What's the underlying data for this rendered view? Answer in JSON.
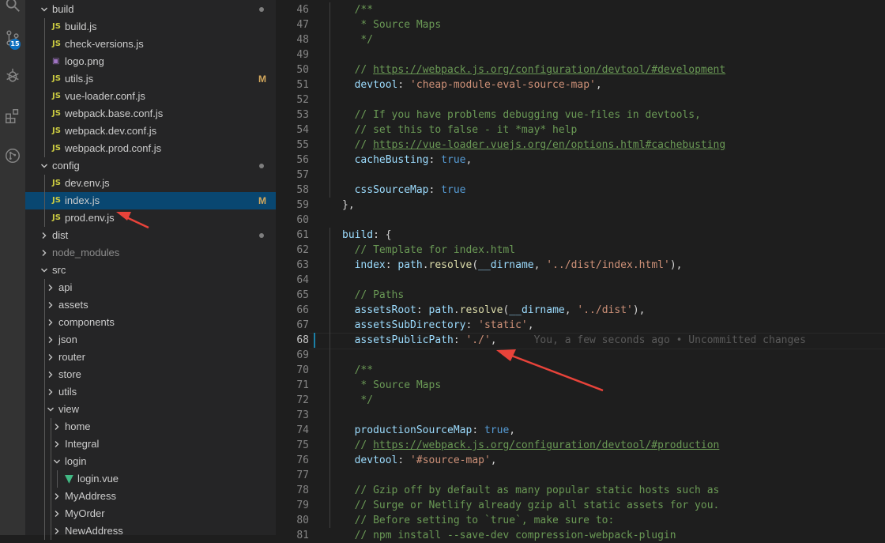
{
  "activity": {
    "scm_badge": "15"
  },
  "explorer": {
    "rows": [
      {
        "label": "build",
        "kind": "folder",
        "open": true,
        "depth": 1,
        "dot": true
      },
      {
        "label": "build.js",
        "kind": "js",
        "depth": 2
      },
      {
        "label": "check-versions.js",
        "kind": "js",
        "depth": 2
      },
      {
        "label": "logo.png",
        "kind": "img",
        "depth": 2
      },
      {
        "label": "utils.js",
        "kind": "js",
        "depth": 2,
        "status": "M"
      },
      {
        "label": "vue-loader.conf.js",
        "kind": "js",
        "depth": 2
      },
      {
        "label": "webpack.base.conf.js",
        "kind": "js",
        "depth": 2
      },
      {
        "label": "webpack.dev.conf.js",
        "kind": "js",
        "depth": 2
      },
      {
        "label": "webpack.prod.conf.js",
        "kind": "js",
        "depth": 2
      },
      {
        "label": "config",
        "kind": "folder",
        "open": true,
        "depth": 1,
        "dot": true
      },
      {
        "label": "dev.env.js",
        "kind": "js",
        "depth": 2
      },
      {
        "label": "index.js",
        "kind": "js",
        "depth": 2,
        "status": "M",
        "selected": true
      },
      {
        "label": "prod.env.js",
        "kind": "js",
        "depth": 2
      },
      {
        "label": "dist",
        "kind": "folder",
        "open": false,
        "depth": 1,
        "dot": true
      },
      {
        "label": "node_modules",
        "kind": "folder",
        "open": false,
        "depth": 1,
        "dim": true
      },
      {
        "label": "src",
        "kind": "folder",
        "open": true,
        "depth": 1
      },
      {
        "label": "api",
        "kind": "folder",
        "open": false,
        "depth": 2
      },
      {
        "label": "assets",
        "kind": "folder",
        "open": false,
        "depth": 2
      },
      {
        "label": "components",
        "kind": "folder",
        "open": false,
        "depth": 2
      },
      {
        "label": "json",
        "kind": "folder",
        "open": false,
        "depth": 2
      },
      {
        "label": "router",
        "kind": "folder",
        "open": false,
        "depth": 2
      },
      {
        "label": "store",
        "kind": "folder",
        "open": false,
        "depth": 2
      },
      {
        "label": "utils",
        "kind": "folder",
        "open": false,
        "depth": 2
      },
      {
        "label": "view",
        "kind": "folder",
        "open": true,
        "depth": 2
      },
      {
        "label": "home",
        "kind": "folder",
        "open": false,
        "depth": 3
      },
      {
        "label": "Integral",
        "kind": "folder",
        "open": false,
        "depth": 3
      },
      {
        "label": "login",
        "kind": "folder",
        "open": true,
        "depth": 3
      },
      {
        "label": "login.vue",
        "kind": "vue",
        "depth": 4
      },
      {
        "label": "MyAddress",
        "kind": "folder",
        "open": false,
        "depth": 3
      },
      {
        "label": "MyOrder",
        "kind": "folder",
        "open": false,
        "depth": 3
      },
      {
        "label": "NewAddress",
        "kind": "folder",
        "open": false,
        "depth": 3
      }
    ],
    "icon_text": {
      "js": "JS",
      "img": "▣",
      "vue": "▼"
    }
  },
  "editor": {
    "active_line": "68",
    "blame": "You, a few seconds ago • Uncommitted changes",
    "lines": [
      {
        "n": "46",
        "indent": 2,
        "seg": [
          [
            "cm",
            "/**"
          ]
        ]
      },
      {
        "n": "47",
        "indent": 2,
        "seg": [
          [
            "cm",
            " * Source Maps"
          ]
        ]
      },
      {
        "n": "48",
        "indent": 2,
        "seg": [
          [
            "cm",
            " */"
          ]
        ]
      },
      {
        "n": "49",
        "indent": 0,
        "seg": []
      },
      {
        "n": "50",
        "indent": 2,
        "seg": [
          [
            "cm",
            "// "
          ],
          [
            "cm-link",
            "https://webpack.js.org/configuration/devtool/#development"
          ]
        ]
      },
      {
        "n": "51",
        "indent": 2,
        "seg": [
          [
            "kw",
            "devtool"
          ],
          [
            "p",
            ": "
          ],
          [
            "str",
            "'cheap-module-eval-source-map'"
          ],
          [
            "p",
            ","
          ]
        ]
      },
      {
        "n": "52",
        "indent": 0,
        "seg": []
      },
      {
        "n": "53",
        "indent": 2,
        "seg": [
          [
            "cm",
            "// If you have problems debugging vue-files in devtools,"
          ]
        ]
      },
      {
        "n": "54",
        "indent": 2,
        "seg": [
          [
            "cm",
            "// set this to false - it *may* help"
          ]
        ]
      },
      {
        "n": "55",
        "indent": 2,
        "seg": [
          [
            "cm",
            "// "
          ],
          [
            "cm-link",
            "https://vue-loader.vuejs.org/en/options.html#cachebusting"
          ]
        ]
      },
      {
        "n": "56",
        "indent": 2,
        "seg": [
          [
            "kw",
            "cacheBusting"
          ],
          [
            "p",
            ": "
          ],
          [
            "bool",
            "true"
          ],
          [
            "p",
            ","
          ]
        ]
      },
      {
        "n": "57",
        "indent": 0,
        "seg": []
      },
      {
        "n": "58",
        "indent": 2,
        "seg": [
          [
            "kw",
            "cssSourceMap"
          ],
          [
            "p",
            ": "
          ],
          [
            "bool",
            "true"
          ]
        ]
      },
      {
        "n": "59",
        "indent": 1,
        "seg": [
          [
            "p",
            "},"
          ]
        ]
      },
      {
        "n": "60",
        "indent": 0,
        "seg": []
      },
      {
        "n": "61",
        "indent": 1,
        "seg": [
          [
            "kw",
            "build"
          ],
          [
            "p",
            ": {"
          ]
        ]
      },
      {
        "n": "62",
        "indent": 2,
        "seg": [
          [
            "cm",
            "// Template for index.html"
          ]
        ]
      },
      {
        "n": "63",
        "indent": 2,
        "seg": [
          [
            "kw",
            "index"
          ],
          [
            "p",
            ": "
          ],
          [
            "kw",
            "path"
          ],
          [
            "p",
            "."
          ],
          [
            "fn",
            "resolve"
          ],
          [
            "p",
            "("
          ],
          [
            "kw",
            "__dirname"
          ],
          [
            "p",
            ", "
          ],
          [
            "str",
            "'../dist/index.html'"
          ],
          [
            "p",
            "),"
          ]
        ]
      },
      {
        "n": "64",
        "indent": 0,
        "seg": []
      },
      {
        "n": "65",
        "indent": 2,
        "seg": [
          [
            "cm",
            "// Paths"
          ]
        ]
      },
      {
        "n": "66",
        "indent": 2,
        "seg": [
          [
            "kw",
            "assetsRoot"
          ],
          [
            "p",
            ": "
          ],
          [
            "kw",
            "path"
          ],
          [
            "p",
            "."
          ],
          [
            "fn",
            "resolve"
          ],
          [
            "p",
            "("
          ],
          [
            "kw",
            "__dirname"
          ],
          [
            "p",
            ", "
          ],
          [
            "str",
            "'../dist'"
          ],
          [
            "p",
            "),"
          ]
        ]
      },
      {
        "n": "67",
        "indent": 2,
        "seg": [
          [
            "kw",
            "assetsSubDirectory"
          ],
          [
            "p",
            ": "
          ],
          [
            "str",
            "'static'"
          ],
          [
            "p",
            ","
          ]
        ]
      },
      {
        "n": "68",
        "indent": 2,
        "seg": [
          [
            "kw",
            "assetsPublicPath"
          ],
          [
            "p",
            ": "
          ],
          [
            "str",
            "'./'"
          ],
          [
            "p",
            ","
          ],
          [
            "blame",
            "      You, a few seconds ago • Uncommitted changes"
          ]
        ]
      },
      {
        "n": "69",
        "indent": 0,
        "seg": []
      },
      {
        "n": "70",
        "indent": 2,
        "seg": [
          [
            "cm",
            "/**"
          ]
        ]
      },
      {
        "n": "71",
        "indent": 2,
        "seg": [
          [
            "cm",
            " * Source Maps"
          ]
        ]
      },
      {
        "n": "72",
        "indent": 2,
        "seg": [
          [
            "cm",
            " */"
          ]
        ]
      },
      {
        "n": "73",
        "indent": 0,
        "seg": []
      },
      {
        "n": "74",
        "indent": 2,
        "seg": [
          [
            "kw",
            "productionSourceMap"
          ],
          [
            "p",
            ": "
          ],
          [
            "bool",
            "true"
          ],
          [
            "p",
            ","
          ]
        ]
      },
      {
        "n": "75",
        "indent": 2,
        "seg": [
          [
            "cm",
            "// "
          ],
          [
            "cm-link",
            "https://webpack.js.org/configuration/devtool/#production"
          ]
        ]
      },
      {
        "n": "76",
        "indent": 2,
        "seg": [
          [
            "kw",
            "devtool"
          ],
          [
            "p",
            ": "
          ],
          [
            "str",
            "'#source-map'"
          ],
          [
            "p",
            ","
          ]
        ]
      },
      {
        "n": "77",
        "indent": 0,
        "seg": []
      },
      {
        "n": "78",
        "indent": 2,
        "seg": [
          [
            "cm",
            "// Gzip off by default as many popular static hosts such as"
          ]
        ]
      },
      {
        "n": "79",
        "indent": 2,
        "seg": [
          [
            "cm",
            "// Surge or Netlify already gzip all static assets for you."
          ]
        ]
      },
      {
        "n": "80",
        "indent": 2,
        "seg": [
          [
            "cm",
            "// Before setting to `true`, make sure to:"
          ]
        ]
      },
      {
        "n": "81",
        "indent": 2,
        "seg": [
          [
            "cm",
            "// npm install --save-dev compression-webpack-plugin"
          ]
        ]
      }
    ]
  },
  "colors": {
    "arrow": "#e8433a",
    "selection": "#094771",
    "modified": "#d3a85c"
  }
}
